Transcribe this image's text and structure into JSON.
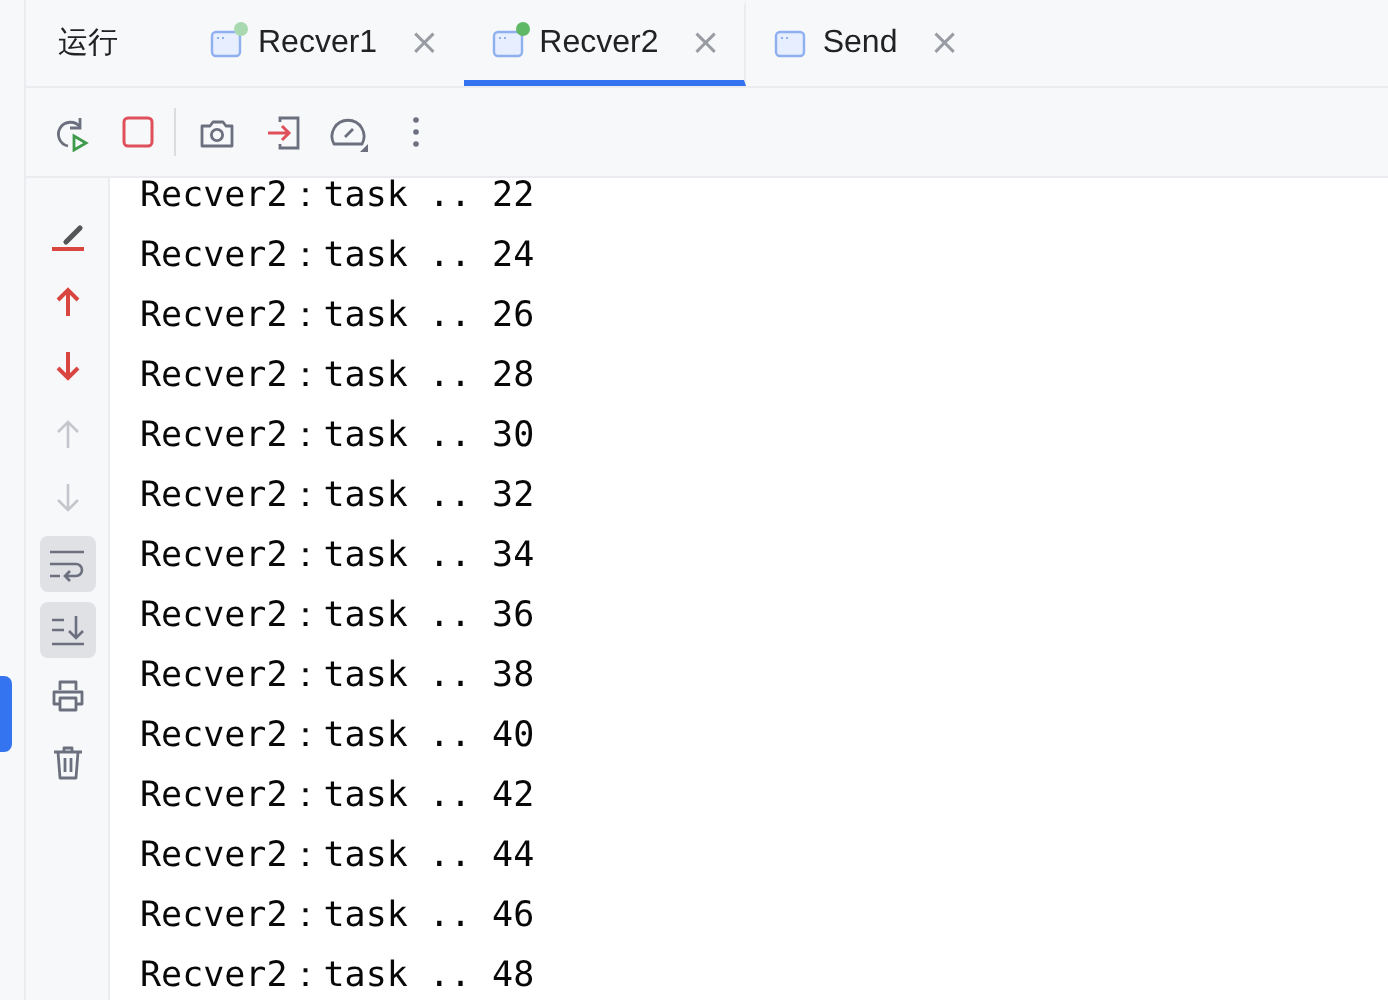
{
  "panel_title": "运行",
  "tabs": [
    {
      "label": "Recver1",
      "selected": false,
      "color": "#a9d9b1"
    },
    {
      "label": "Recver2",
      "selected": true,
      "color": "#5fb865"
    },
    {
      "label": "Send",
      "selected": false
    }
  ],
  "tab_close": "×",
  "toolbar": [
    {
      "kind": "rerun"
    },
    {
      "kind": "stop"
    },
    {
      "kind": "sep"
    },
    {
      "kind": "camera"
    },
    {
      "kind": "exit"
    },
    {
      "kind": "gauge"
    },
    {
      "kind": "more"
    }
  ],
  "side_tools": [
    {
      "kind": "clear",
      "on": false,
      "disabled": false
    },
    {
      "kind": "up-red",
      "on": false,
      "disabled": false
    },
    {
      "kind": "down-red",
      "on": false,
      "disabled": false
    },
    {
      "kind": "up",
      "on": false,
      "disabled": true
    },
    {
      "kind": "down",
      "on": false,
      "disabled": true
    },
    {
      "kind": "wrap",
      "on": true,
      "disabled": false
    },
    {
      "kind": "scroll-end",
      "on": true,
      "disabled": false
    },
    {
      "kind": "print",
      "on": false,
      "disabled": false
    },
    {
      "kind": "trash",
      "on": false,
      "disabled": false
    }
  ],
  "console_lines": [
    "Recver2：task .. 22",
    "Recver2：task .. 24",
    "Recver2：task .. 26",
    "Recver2：task .. 28",
    "Recver2：task .. 30",
    "Recver2：task .. 32",
    "Recver2：task .. 34",
    "Recver2：task .. 36",
    "Recver2：task .. 38",
    "Recver2：task .. 40",
    "Recver2：task .. 42",
    "Recver2：task .. 44",
    "Recver2：task .. 46",
    "Recver2：task .. 48"
  ]
}
